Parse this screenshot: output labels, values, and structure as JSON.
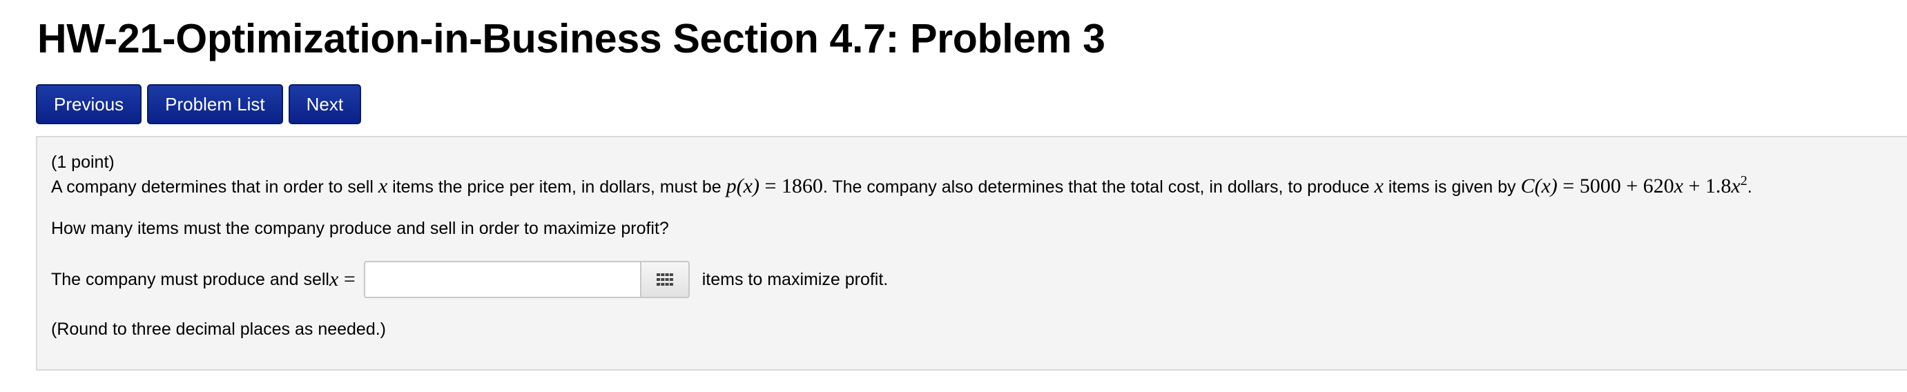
{
  "header": {
    "title": "HW-21-Optimization-in-Business Section 4.7: Problem 3"
  },
  "nav": {
    "previous_label": "Previous",
    "problem_list_label": "Problem List",
    "next_label": "Next"
  },
  "problem": {
    "points": "(1 point)",
    "statement_part1": "A company determines that in order to sell ",
    "var_x": "x",
    "statement_part2": " items the price per item, in dollars, must be ",
    "price_func": "p(x)",
    "equals": " = ",
    "price_value": "1860",
    "statement_part3": ". The company also determines that the total cost, in dollars, to produce ",
    "statement_part4": " items is given by ",
    "cost_func": "C(x)",
    "cost_const": "5000 + 620",
    "cost_mid": " + 1.8",
    "cost_exp": "2",
    "statement_end": ".",
    "question": "How many items must the company produce and sell in order to maximize profit?",
    "answer_prefix": "The company must produce and sell ",
    "answer_input_value": "",
    "answer_suffix": "items to maximize profit.",
    "rounding_note": "(Round to three decimal places as needed.)"
  },
  "icons": {
    "palette": "grid-keypad-icon"
  },
  "colors": {
    "button_bg": "#0a2289",
    "panel_bg": "#f4f4f4"
  }
}
